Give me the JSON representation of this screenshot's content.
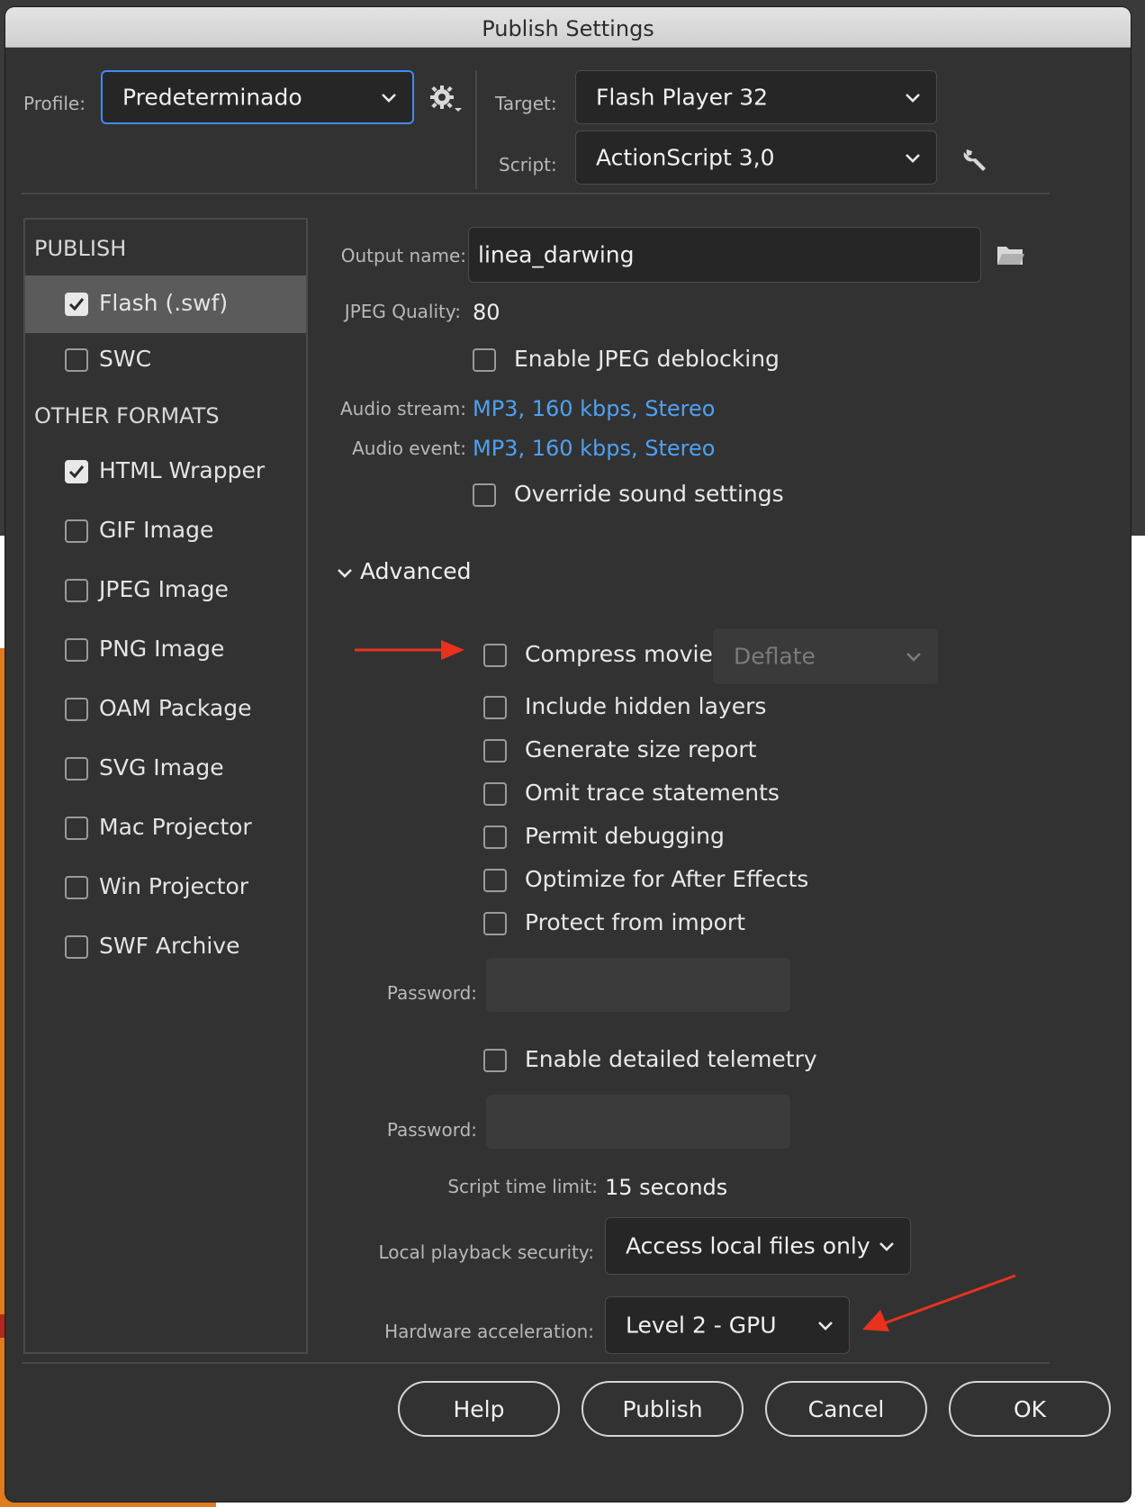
{
  "window": {
    "title": "Publish Settings"
  },
  "profile": {
    "label": "Profile:",
    "value": "Predeterminado"
  },
  "target": {
    "label": "Target:",
    "value": "Flash Player 32"
  },
  "script": {
    "label": "Script:",
    "value": "ActionScript 3,0"
  },
  "sidebar": {
    "publish_heading": "PUBLISH",
    "other_heading": "OTHER FORMATS",
    "publish_items": [
      {
        "label": "Flash (.swf)",
        "checked": true,
        "selected": true
      },
      {
        "label": "SWC",
        "checked": false
      }
    ],
    "other_items": [
      {
        "label": "HTML Wrapper",
        "checked": true
      },
      {
        "label": "GIF Image",
        "checked": false
      },
      {
        "label": "JPEG Image",
        "checked": false
      },
      {
        "label": "PNG Image",
        "checked": false
      },
      {
        "label": "OAM Package",
        "checked": false
      },
      {
        "label": "SVG Image",
        "checked": false
      },
      {
        "label": "Mac Projector",
        "checked": false
      },
      {
        "label": "Win Projector",
        "checked": false
      },
      {
        "label": "SWF Archive",
        "checked": false
      }
    ]
  },
  "output": {
    "label": "Output name:",
    "value": "linea_darwing"
  },
  "jpeg": {
    "label": "JPEG Quality:",
    "value": "80",
    "deblocking_label": "Enable JPEG deblocking",
    "deblocking": false
  },
  "audio": {
    "stream_label": "Audio stream:",
    "stream_value": "MP3, 160 kbps, Stereo",
    "event_label": "Audio event:",
    "event_value": "MP3, 160 kbps, Stereo",
    "override_label": "Override sound settings",
    "override": false
  },
  "advanced": {
    "label": "Advanced",
    "compress_label": "Compress movie",
    "compress": false,
    "compress_method": "Deflate",
    "options": [
      {
        "label": "Include hidden layers",
        "checked": false
      },
      {
        "label": "Generate size report",
        "checked": false
      },
      {
        "label": "Omit trace statements",
        "checked": false
      },
      {
        "label": "Permit debugging",
        "checked": false
      },
      {
        "label": "Optimize for After Effects",
        "checked": false
      },
      {
        "label": "Protect from import",
        "checked": false
      }
    ],
    "password_label": "Password:",
    "telemetry_label": "Enable detailed telemetry",
    "telemetry": false,
    "password2_label": "Password:",
    "time_limit_label": "Script time limit:",
    "time_limit_value": "15 seconds",
    "local_security_label": "Local playback security:",
    "local_security_value": "Access local files only",
    "hw_accel_label": "Hardware acceleration:",
    "hw_accel_value": "Level 2 - GPU"
  },
  "buttons": {
    "help": "Help",
    "publish": "Publish",
    "cancel": "Cancel",
    "ok": "OK"
  },
  "colors": {
    "annotation_arrow": "#e8321e",
    "link": "#4ea1f3",
    "focus": "#3d8df5"
  }
}
